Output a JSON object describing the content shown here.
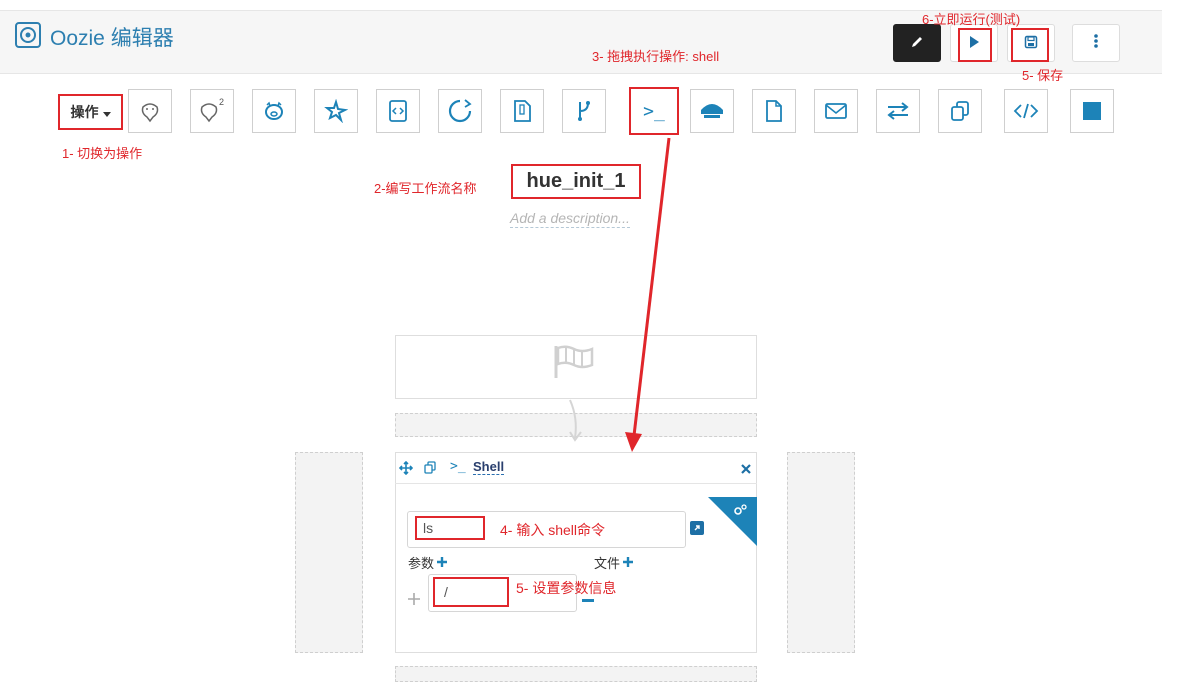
{
  "header": {
    "title": "Oozie 编辑器"
  },
  "toolbar": {
    "actions_label": "操作",
    "tools": [
      "hive-icon",
      "hive2-icon",
      "pig-icon",
      "spark-icon",
      "java-icon",
      "sub-workflow-icon",
      "sqoop-icon",
      "distcp-icon",
      "shell-icon",
      "ssh-icon",
      "fs-icon",
      "email-icon",
      "streaming-icon",
      "generic-icon",
      "xml-icon",
      "end-icon"
    ]
  },
  "workflow": {
    "name": "hue_init_1",
    "description_placeholder": "Add a description..."
  },
  "node": {
    "type_symbol": ">_",
    "type_label": "Shell",
    "command_value": "ls",
    "params_label": "参数",
    "files_label": "文件",
    "param_value": "/"
  },
  "annotations": {
    "step1": "1- 切换为操作",
    "step2": "2-编写工作流名称",
    "step3": "3- 拖拽执行操作: shell",
    "step4": "4- 输入 shell命令",
    "step5_param": "5- 设置参数信息",
    "step5_save": "5- 保存",
    "step6": "6-立即运行(测试)"
  },
  "colors": {
    "brand": "#2d7fb0",
    "icon": "#1d83b8",
    "annotation": "#e0262b"
  }
}
